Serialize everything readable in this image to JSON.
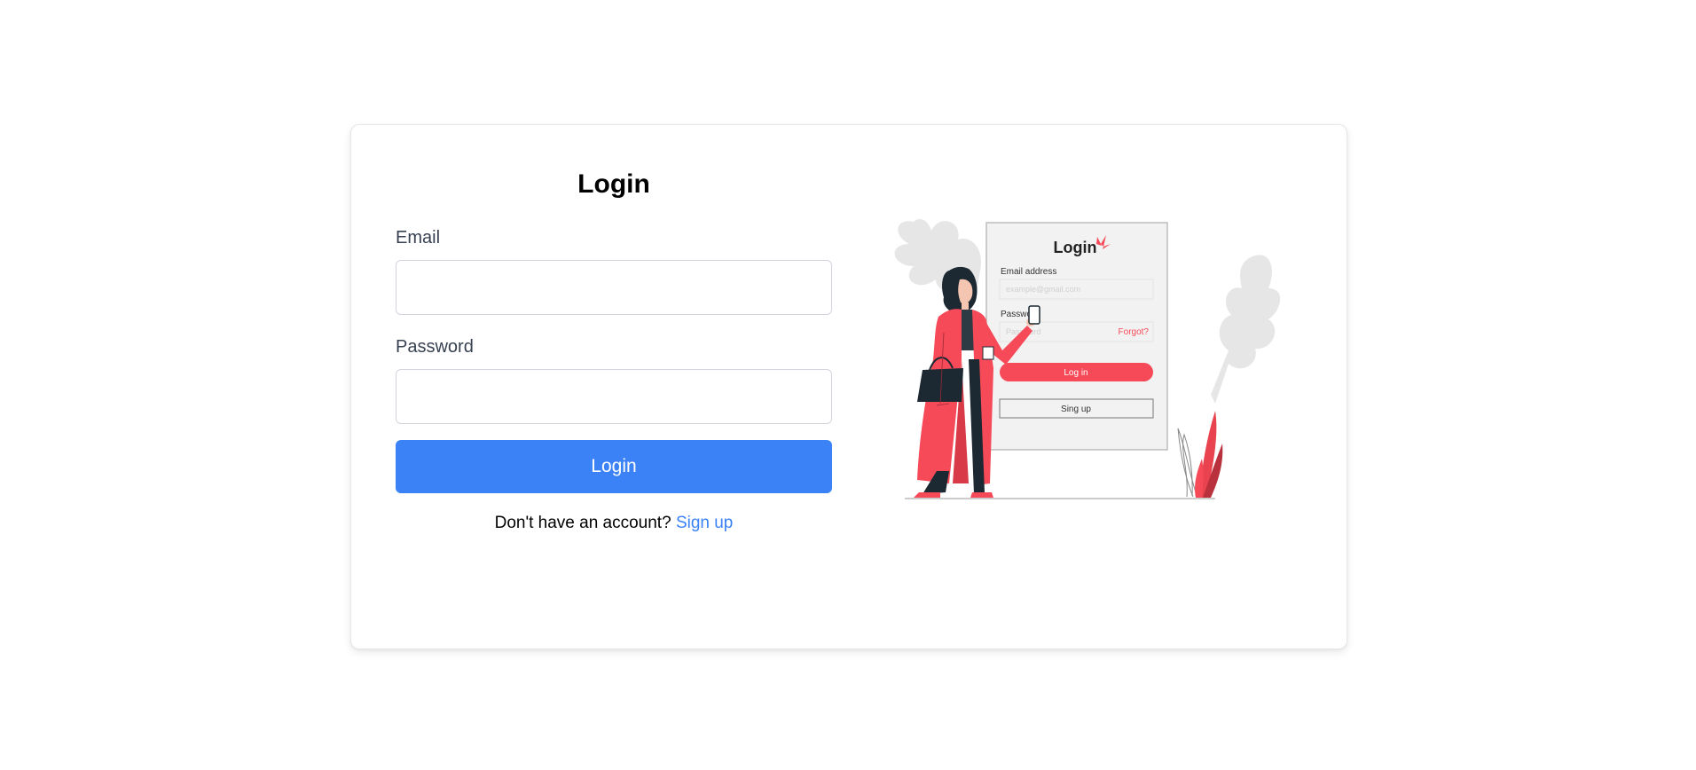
{
  "form": {
    "title": "Login",
    "email_label": "Email",
    "email_value": "",
    "password_label": "Password",
    "password_value": "",
    "login_button": "Login",
    "signup_prompt": "Don't have an account?",
    "signup_link": "Sign up"
  },
  "illustration": {
    "title": "Login",
    "email_label": "Email address",
    "email_placeholder": "example@gmail.com",
    "password_label": "Password",
    "password_placeholder": "Password",
    "forgot": "Forgot?",
    "login_button": "Log in",
    "signup_button": "Sing up"
  },
  "colors": {
    "primary": "#3b82f6",
    "illustration_accent": "#f64a58"
  }
}
